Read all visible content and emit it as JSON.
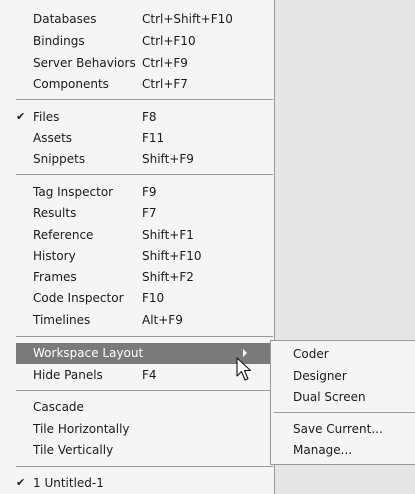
{
  "menu": {
    "items": [
      {
        "label": "Databases",
        "shortcut": "Ctrl+Shift+F10"
      },
      {
        "label": "Bindings",
        "shortcut": "Ctrl+F10"
      },
      {
        "label": "Server Behaviors",
        "shortcut": "Ctrl+F9"
      },
      {
        "label": "Components",
        "shortcut": "Ctrl+F7"
      },
      {
        "label": "Files",
        "shortcut": "F8",
        "checked": true
      },
      {
        "label": "Assets",
        "shortcut": "F11"
      },
      {
        "label": "Snippets",
        "shortcut": "Shift+F9"
      },
      {
        "label": "Tag Inspector",
        "shortcut": "F9"
      },
      {
        "label": "Results",
        "shortcut": "F7"
      },
      {
        "label": "Reference",
        "shortcut": "Shift+F1"
      },
      {
        "label": "History",
        "shortcut": "Shift+F10"
      },
      {
        "label": "Frames",
        "shortcut": "Shift+F2"
      },
      {
        "label": "Code Inspector",
        "shortcut": "F10"
      },
      {
        "label": "Timelines",
        "shortcut": "Alt+F9"
      },
      {
        "label": "Workspace Layout",
        "shortcut": "",
        "highlighted": true,
        "has_submenu": true
      },
      {
        "label": "Hide Panels",
        "shortcut": "F4"
      },
      {
        "label": "Cascade",
        "shortcut": ""
      },
      {
        "label": "Tile Horizontally",
        "shortcut": ""
      },
      {
        "label": "Tile Vertically",
        "shortcut": ""
      },
      {
        "label": "1 Untitled-1",
        "shortcut": "",
        "checked": true
      }
    ],
    "check_glyph": "✔",
    "highlight_color": "#7a7a7a"
  },
  "submenu": {
    "items": [
      {
        "label": "Coder"
      },
      {
        "label": "Designer"
      },
      {
        "label": "Dual Screen"
      },
      {
        "label": "Save Current..."
      },
      {
        "label": "Manage..."
      }
    ]
  }
}
